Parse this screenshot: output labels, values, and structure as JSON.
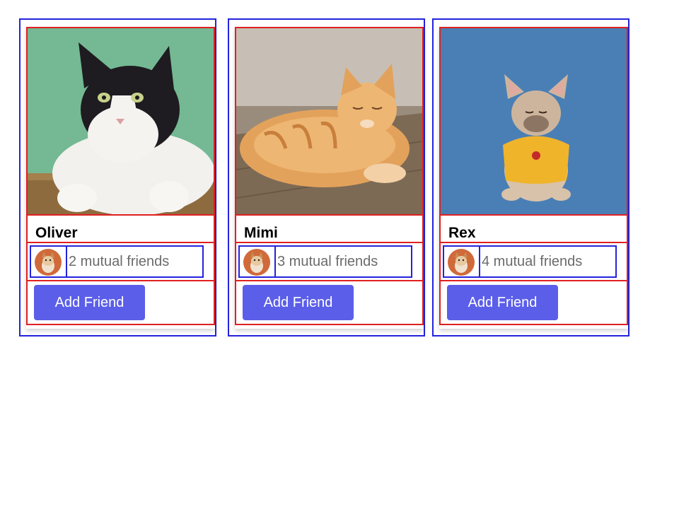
{
  "cards": [
    {
      "name": "Oliver",
      "mutual": "2 mutual friends",
      "button": "Add Friend",
      "photo_icon": "cat-photo",
      "photo_color": "#6fb590"
    },
    {
      "name": "Mimi",
      "mutual": "3 mutual friends",
      "button": "Add Friend",
      "photo_icon": "cat-photo",
      "photo_color": "#8a7a68"
    },
    {
      "name": "Rex",
      "mutual": "4 mutual friends",
      "button": "Add Friend",
      "photo_icon": "dog-photo",
      "photo_color": "#4a7fb5"
    }
  ],
  "colors": {
    "button_bg": "#5b5ee8",
    "outline_red": "#e02020",
    "outline_blue": "#2323dd",
    "mutual_text": "#6b6b6b"
  }
}
